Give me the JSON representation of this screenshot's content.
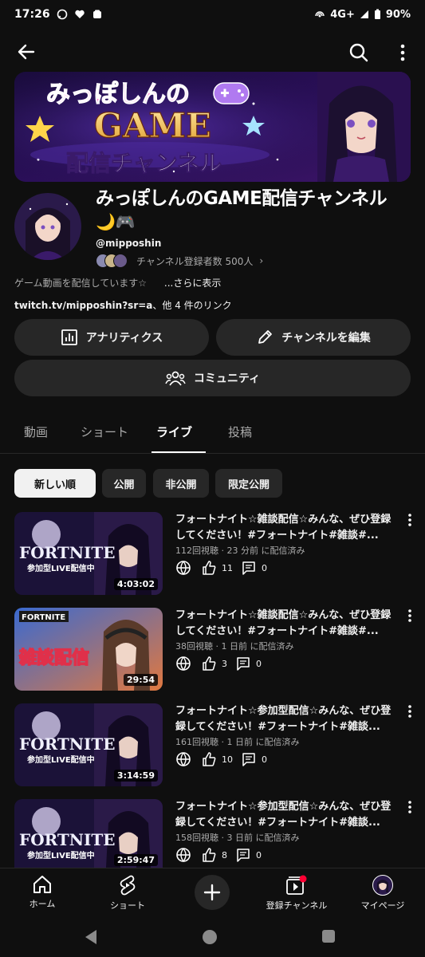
{
  "status_bar": {
    "time": "17:26",
    "network": "4G+",
    "battery": "90%"
  },
  "channel": {
    "banner_text_line1": "みっぽしんの",
    "banner_text_line2": "GAME",
    "banner_text_line3": "配信チャンネル",
    "name": "みっぽしんのGAME配信チャンネル",
    "emoji": "🌙🎮",
    "handle": "@mipposhin",
    "subscribers": "チャンネル登録者数 500人",
    "subscribers_chevron": "›",
    "description": "ゲーム動画を配信しています☆",
    "description_more": "...さらに表示",
    "link_main": "twitch.tv/mipposhin?sr=a",
    "link_other": "、他 4 件のリンク"
  },
  "actions": {
    "analytics": "アナリティクス",
    "edit": "チャンネルを編集",
    "community": "コミュニティ"
  },
  "tabs": [
    {
      "label": "動画"
    },
    {
      "label": "ショート"
    },
    {
      "label": "ライブ"
    },
    {
      "label": "投稿"
    }
  ],
  "chips": [
    {
      "label": "新しい順"
    },
    {
      "label": "公開"
    },
    {
      "label": "非公開"
    },
    {
      "label": "限定公開"
    }
  ],
  "videos": [
    {
      "title": "フォートナイト☆雑談配信☆みんな、ぜひ登録してください！#フォートナイト#雑談#...",
      "meta": "112回視聴 · 23 分前 に配信済み",
      "likes": "11",
      "comments": "0",
      "duration": "4:03:02",
      "thumb_title": "FORTNITE",
      "thumb_sub": "参加型LIVE配信中"
    },
    {
      "title": "フォートナイト☆雑談配信☆みんな、ぜひ登録してください！#フォートナイト#雑談#...",
      "meta": "38回視聴 · 1 日前 に配信済み",
      "likes": "3",
      "comments": "0",
      "duration": "29:54",
      "thumb_title": "FORTNITE",
      "thumb_sub": "雑談配信"
    },
    {
      "title": "フォートナイト☆参加型配信☆みんな、ぜひ登録してください！#フォートナイト#雑談...",
      "meta": "161回視聴 · 1 日前 に配信済み",
      "likes": "10",
      "comments": "0",
      "duration": "3:14:59",
      "thumb_title": "FORTNITE",
      "thumb_sub": "参加型LIVE配信中"
    },
    {
      "title": "フォートナイト☆参加型配信☆みんな、ぜひ登録してください！#フォートナイト#雑談...",
      "meta": "158回視聴 · 3 日前 に配信済み",
      "likes": "8",
      "comments": "0",
      "duration": "2:59:47",
      "thumb_title": "FORTNITE",
      "thumb_sub": "参加型LIVE配信中"
    }
  ],
  "bottom_nav": {
    "home": "ホーム",
    "shorts": "ショート",
    "subscriptions": "登録チャンネル",
    "my_page": "マイページ"
  },
  "colors": {
    "background": "#0f0f0f",
    "surface": "#272727",
    "accent_red": "#ff0033",
    "text_secondary": "#aaaaaa"
  }
}
